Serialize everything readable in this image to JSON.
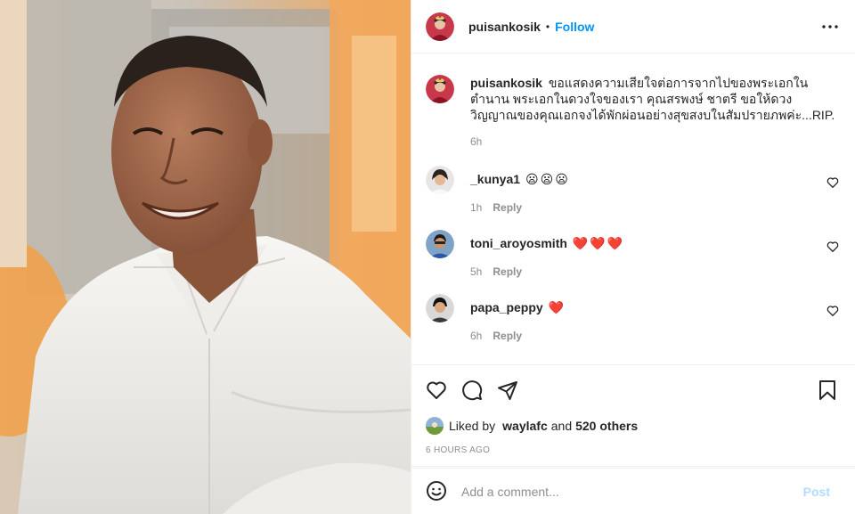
{
  "post": {
    "username": "puisankosik",
    "separator": "•",
    "follow_label": "Follow",
    "more_icon": "more-horizontal-icon"
  },
  "caption": {
    "username": "puisankosik",
    "text": "ขอแสดงความเสียใจต่อการจากไปของพระเอกในตำนาน พระเอกในดวงใจของเรา คุณสรพงษ์ ชาตรี ขอให้ดวงวิญญาณของคุณเอกจงได้พักผ่อนอย่างสุขสงบในสัมปรายภพค่ะ...RIP.",
    "time": "6h"
  },
  "comments": [
    {
      "username": "_kunya1",
      "emojis": [
        "😦",
        "😦",
        "😦"
      ],
      "time": "1h",
      "reply_label": "Reply"
    },
    {
      "username": "toni_aroyosmith",
      "emojis": [
        "❤️",
        "❤️",
        "❤️"
      ],
      "time": "5h",
      "reply_label": "Reply"
    },
    {
      "username": "papa_peppy",
      "emojis": [
        "❤️"
      ],
      "time": "6h",
      "reply_label": "Reply"
    }
  ],
  "likes": {
    "prefix": "Liked by",
    "first_user": "waylafc",
    "joiner": "and",
    "others": "520 others"
  },
  "time_ago": "6 HOURS AGO",
  "add_comment": {
    "placeholder": "Add a comment...",
    "post_label": "Post"
  },
  "colors": {
    "accent": "#0095f6",
    "post_disabled": "#b3dbff",
    "muted": "#8e8e8e",
    "text": "#262626",
    "heart_red": "#ed1c24"
  }
}
